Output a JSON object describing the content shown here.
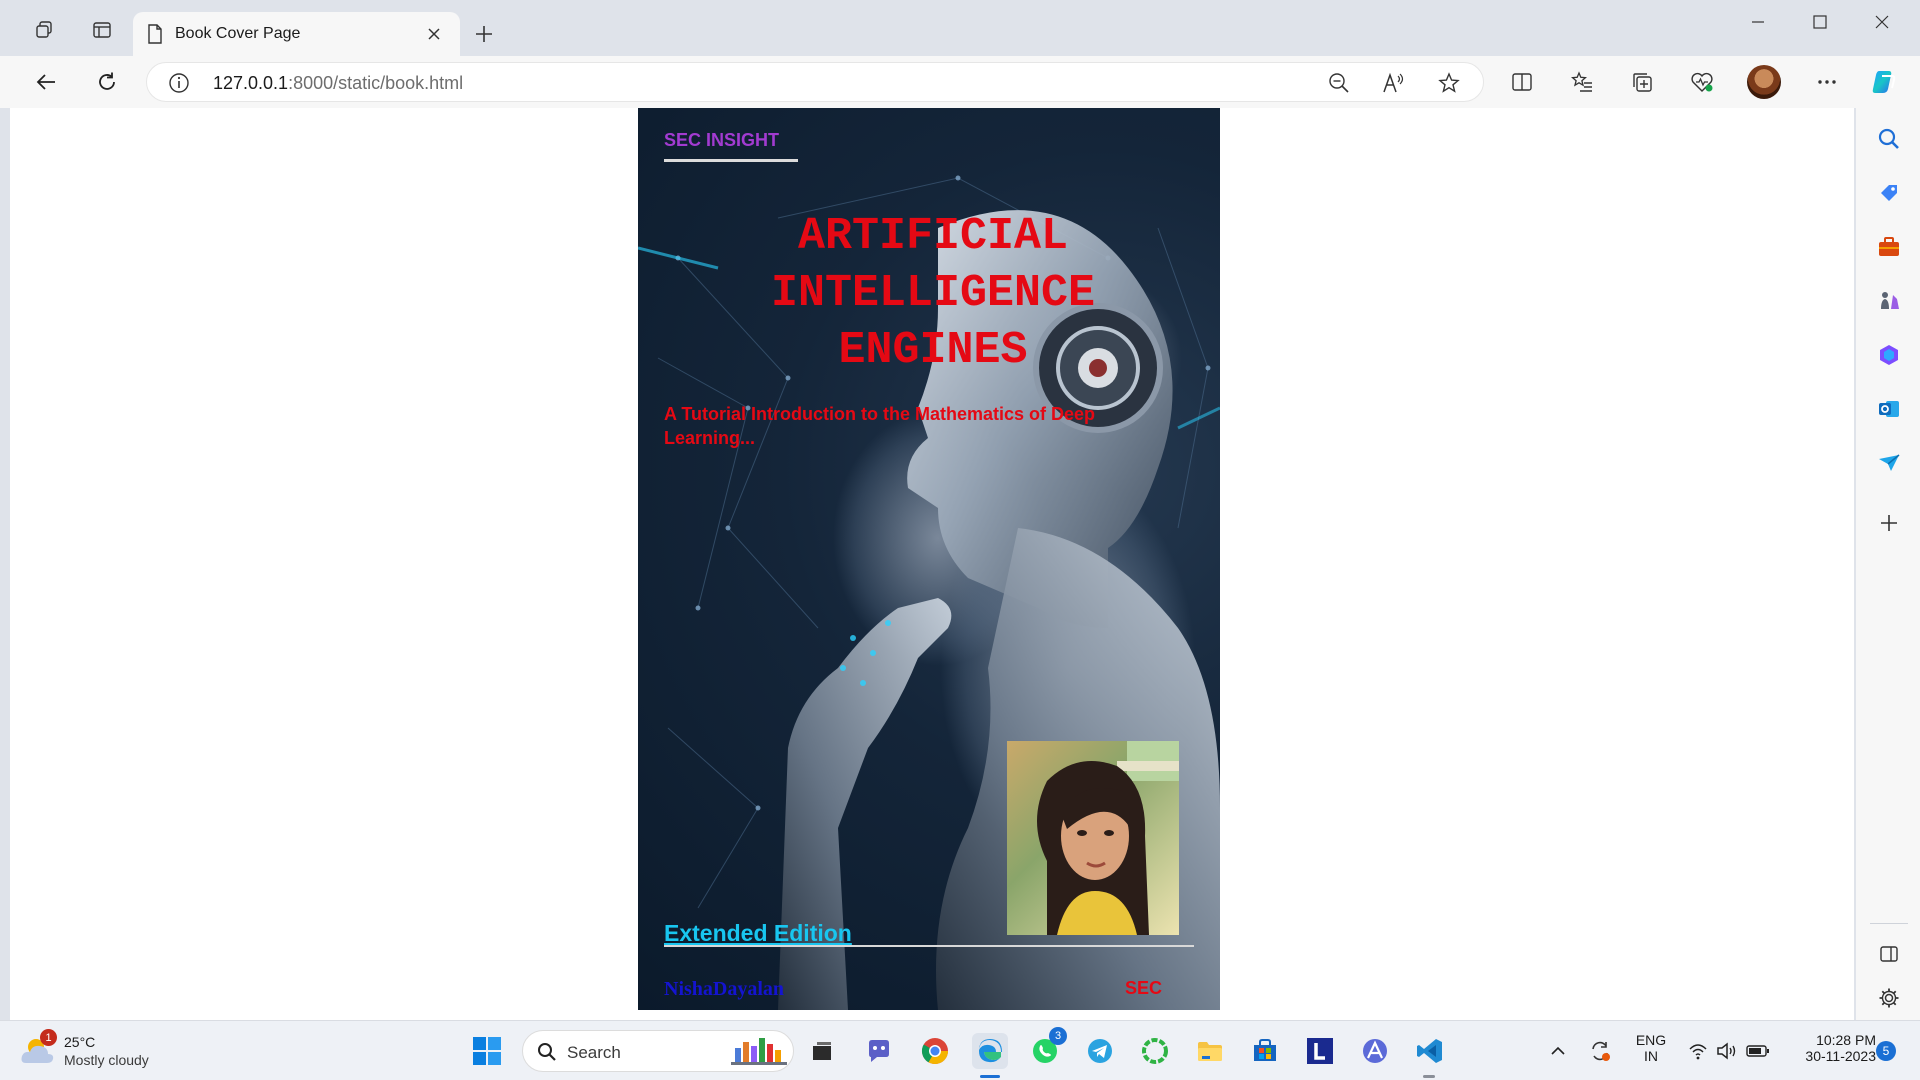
{
  "browser": {
    "tab": {
      "title": "Book Cover Page"
    },
    "address": {
      "host": "127.0.0.1",
      "rest": ":8000/static/book.html"
    }
  },
  "book": {
    "series": "SEC INSIGHT",
    "title_lines": [
      "ARTIFICIAL",
      "INTELLIGENCE",
      "ENGINES"
    ],
    "subtitle": "A Tutorial Introduction to the Mathematics of Deep Learning...",
    "edition": "Extended Edition",
    "author": "NishaDayalan",
    "publisher": "SEC"
  },
  "taskbar": {
    "weather": {
      "temp": "25°C",
      "desc": "Mostly cloudy",
      "badge": "1"
    },
    "search_label": "Search",
    "whatsapp_badge": "3",
    "lang": {
      "line1": "ENG",
      "line2": "IN"
    },
    "clock": {
      "time": "10:28 PM",
      "date": "30-11-2023"
    },
    "notif_count": "5"
  },
  "colors": {
    "title": "#e50914",
    "series": "#a23bd1",
    "edition": "#18c6f0",
    "author": "#1414d0",
    "cover_bg": "#142539"
  }
}
